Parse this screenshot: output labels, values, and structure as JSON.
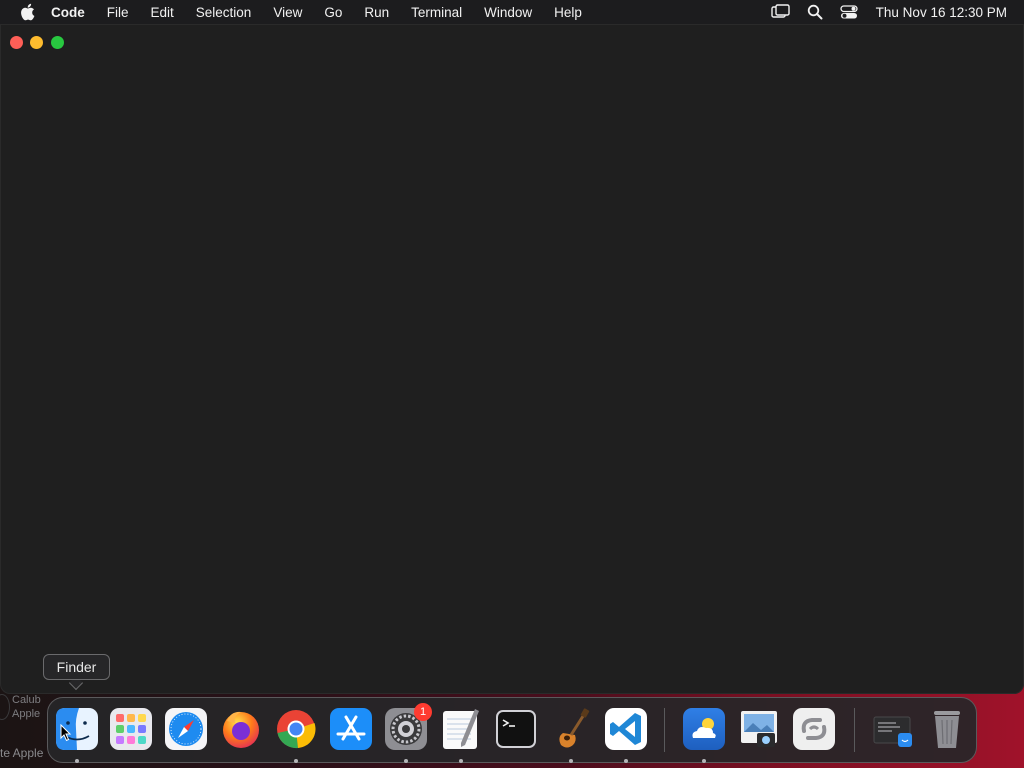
{
  "menubar": {
    "apple_icon": "apple-logo-icon",
    "app_name": "Code",
    "items": [
      "File",
      "Edit",
      "Selection",
      "View",
      "Go",
      "Run",
      "Terminal",
      "Window",
      "Help"
    ],
    "status_icons": [
      "screen-mirroring-icon",
      "spotlight-search-icon",
      "control-center-icon"
    ],
    "clock": "Thu Nov 16  12:30 PM"
  },
  "desktop": {
    "widget_line1": "Calub",
    "widget_line2": "Apple",
    "bottom_text": "te Apple"
  },
  "tooltip": {
    "label": "Finder"
  },
  "dock": {
    "apps": [
      {
        "name": "Finder",
        "icon": "finder-icon",
        "running": true
      },
      {
        "name": "Launchpad",
        "icon": "launchpad-icon",
        "running": false
      },
      {
        "name": "Safari",
        "icon": "safari-icon",
        "running": false
      },
      {
        "name": "Firefox",
        "icon": "firefox-icon",
        "running": false
      },
      {
        "name": "Google Chrome",
        "icon": "chrome-icon",
        "running": true
      },
      {
        "name": "App Store",
        "icon": "app-store-icon",
        "running": false
      },
      {
        "name": "System Settings",
        "icon": "system-settings-icon",
        "running": true,
        "badge": "1"
      },
      {
        "name": "TextEdit",
        "icon": "textedit-icon",
        "running": true
      },
      {
        "name": "Terminal",
        "icon": "terminal-icon",
        "running": false
      },
      {
        "name": "GarageBand",
        "icon": "garageband-icon",
        "running": true
      },
      {
        "name": "Visual Studio Code",
        "icon": "vscode-icon",
        "running": true
      },
      {
        "name": "Weather",
        "icon": "weather-icon",
        "running": true
      },
      {
        "name": "Preview",
        "icon": "preview-icon",
        "running": false
      },
      {
        "name": "Link",
        "icon": "link-app-icon",
        "running": false
      },
      {
        "name": "Downloads Stack",
        "icon": "downloads-stack-icon",
        "running": false
      },
      {
        "name": "Trash",
        "icon": "trash-icon",
        "running": false
      }
    ]
  },
  "colors": {
    "close": "#ff5f57",
    "minimize": "#febc2e",
    "maximize": "#28c840",
    "window_bg": "#1f1f1f",
    "menubar_bg": "#1c1c1e",
    "badge": "#ff3b30"
  }
}
